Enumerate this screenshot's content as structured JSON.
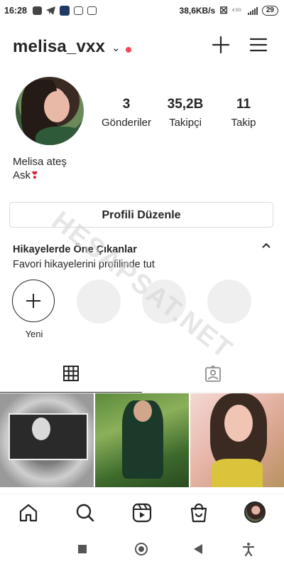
{
  "status_bar": {
    "time": "16:28",
    "speed": "38,6KB/s",
    "signal_label": "4.5G",
    "battery": "29",
    "icons": [
      "message-icon",
      "telegram-icon",
      "app-icon",
      "instagram-icon",
      "instagram-icon",
      "mute-icon",
      "signal-icon",
      "battery-icon"
    ]
  },
  "header": {
    "username": "melisa_vxx",
    "dropdown_icon": "chevron-down-icon",
    "notification_dot_color": "#ed4956",
    "new_post_icon": "plus-icon",
    "menu_icon": "hamburger-menu-icon"
  },
  "profile": {
    "stats": [
      {
        "value": "3",
        "label": "Gönderiler"
      },
      {
        "value": "35,2B",
        "label": "Takipçi"
      },
      {
        "value": "11",
        "label": "Takip"
      }
    ],
    "full_name": "Melisa ateş",
    "bio": "Ask",
    "bio_emoji": "❣"
  },
  "edit_profile_button": "Profili Düzenle",
  "highlights": {
    "title": "Hikayelerde Öne Çıkanlar",
    "subtitle": "Favori hikayelerini profilinde tut",
    "new_label": "Yeni",
    "collapse_icon": "chevron-up-icon"
  },
  "watermark": "HESAPSAT.NET",
  "tabs": [
    {
      "icon": "grid-icon",
      "active": true
    },
    {
      "icon": "tagged-icon",
      "active": false
    }
  ],
  "bottom_nav": [
    {
      "icon": "home-icon"
    },
    {
      "icon": "search-icon"
    },
    {
      "icon": "reels-icon"
    },
    {
      "icon": "shop-icon"
    },
    {
      "icon": "profile-avatar"
    }
  ],
  "system_nav": [
    "recents-square-icon",
    "home-circle-icon",
    "back-triangle-icon",
    "accessibility-icon"
  ]
}
